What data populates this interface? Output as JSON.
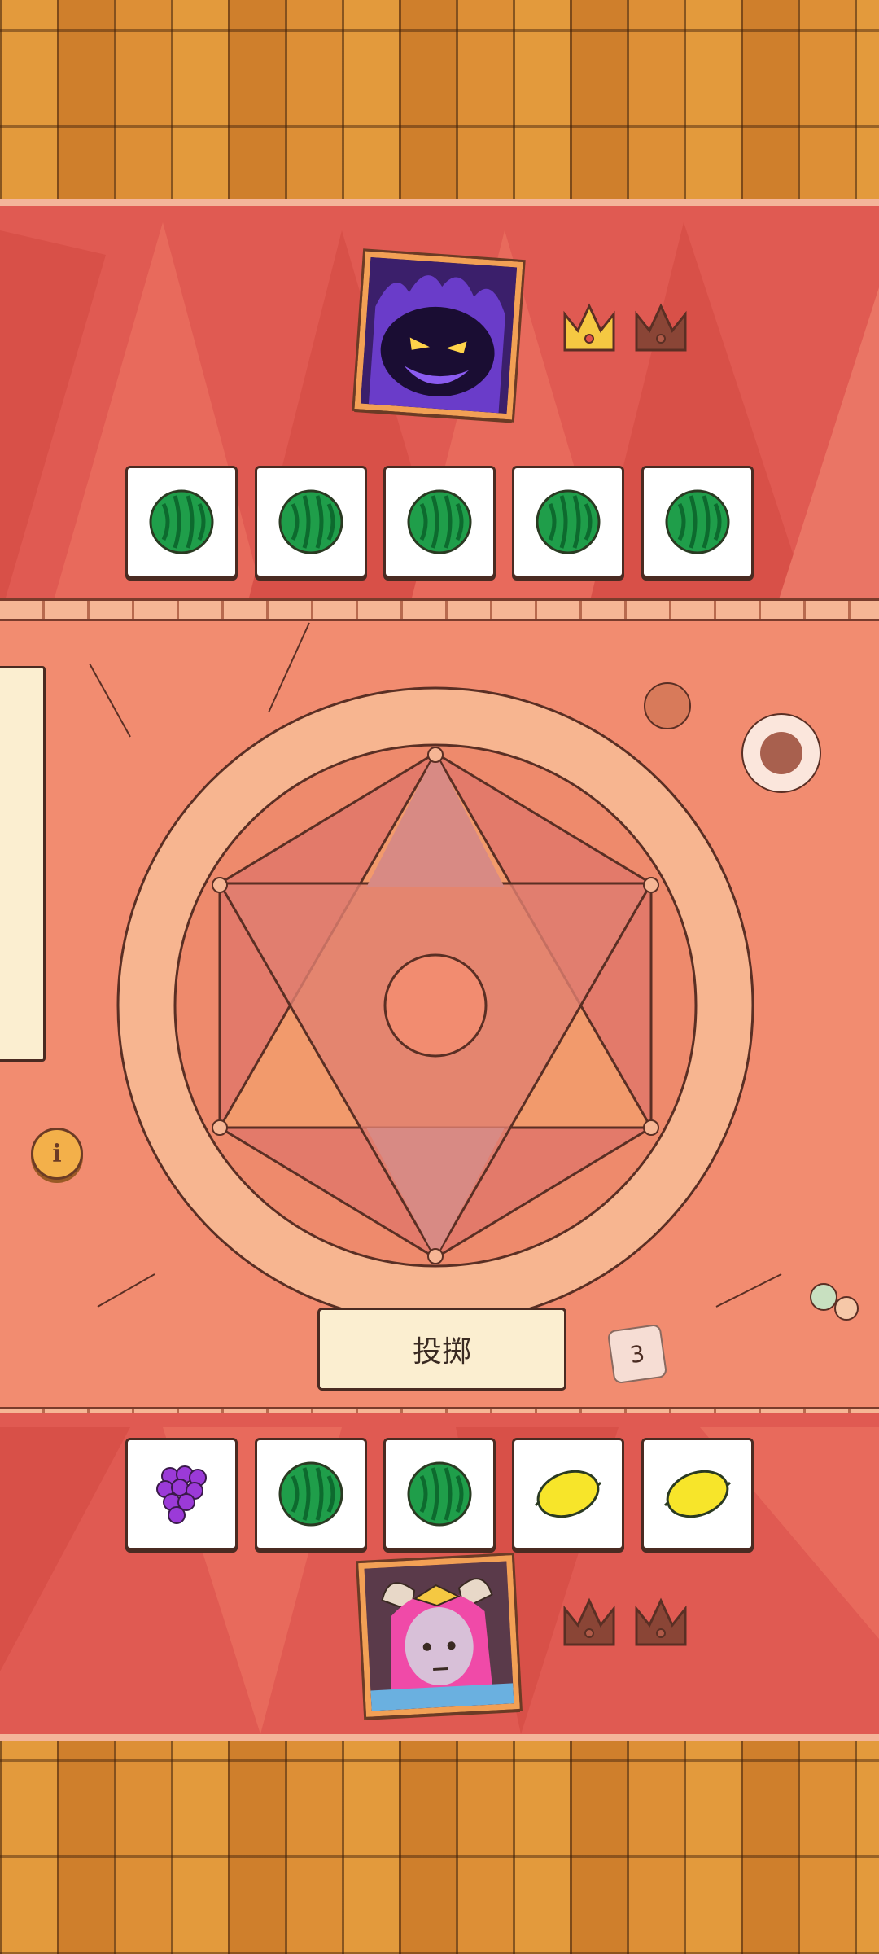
{
  "opponent": {
    "portrait_icon": "shadow-demon-portrait",
    "crowns": [
      "won",
      "empty"
    ],
    "dice": [
      "watermelon",
      "watermelon",
      "watermelon",
      "watermelon",
      "watermelon"
    ]
  },
  "player": {
    "portrait_icon": "pink-horned-girl-portrait",
    "crowns": [
      "empty",
      "empty"
    ],
    "dice": [
      "grapes",
      "watermelon",
      "watermelon",
      "lemon",
      "lemon"
    ]
  },
  "board": {
    "roll_button_label": "投掷",
    "rolls_remaining": "3",
    "info_label": "i"
  },
  "colors": {
    "rug": "#e05a52",
    "table": "#f28c70",
    "crown_won": "#f5c842",
    "crown_empty": "#8a4536"
  }
}
